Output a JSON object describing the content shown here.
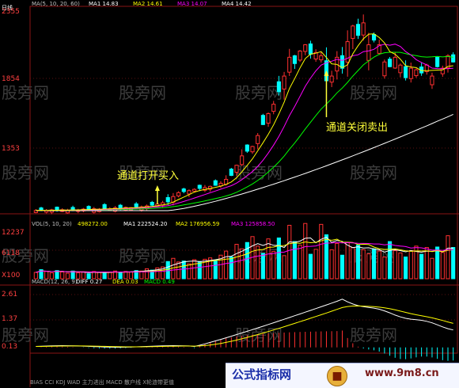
{
  "window": {
    "title": "日线"
  },
  "colors": {
    "up": "#ff3030",
    "down": "#00ffff",
    "ma5": "#ffffff",
    "ma10": "#ffff00",
    "ma20": "#ff00ff",
    "ma60": "#00ff00"
  },
  "watermarks": [
    "股旁网",
    "股旁网",
    "股旁网",
    "股旁网",
    "股旁网",
    "股旁网",
    "股旁网",
    "股旁网",
    "股旁网",
    "股旁网",
    "股旁网",
    "股旁网"
  ],
  "chart_data": [
    {
      "type": "candlestick",
      "title": "MA(5, 10, 20, 60)",
      "legend": [
        {
          "name": "MA1",
          "value": "14.83"
        },
        {
          "name": "MA2",
          "value": "14.61"
        },
        {
          "name": "MA3",
          "value": "14.07"
        },
        {
          "name": "MA4",
          "value": "14.42"
        }
      ],
      "yticks": [
        "2355",
        "1854",
        "1353"
      ],
      "annotations": [
        {
          "text": "通道打开买入",
          "at_index": 23
        },
        {
          "text": "通道关闭卖出",
          "at_index": 55
        }
      ],
      "close": [
        1101,
        1104,
        1100,
        1105,
        1103,
        1106,
        1102,
        1108,
        1105,
        1110,
        1107,
        1112,
        1109,
        1115,
        1112,
        1118,
        1116,
        1121,
        1119,
        1125,
        1124,
        1130,
        1135,
        1142,
        1150,
        1156,
        1190,
        1215,
        1222,
        1228,
        1236,
        1242,
        1248,
        1255,
        1262,
        1275,
        1300,
        1325,
        1390,
        1450,
        1480,
        1510,
        1580,
        1650,
        1720,
        1780,
        1860,
        1960,
        2080,
        2040,
        2120,
        2160,
        2100,
        2110,
        2090,
        1930,
        1960,
        2080,
        2010,
        2180,
        2280,
        2220,
        2300,
        2160,
        2190,
        2160,
        2050,
        2020,
        2080,
        2030,
        1950,
        2010,
        2000,
        1980,
        2030,
        1960,
        2020,
        2010,
        2090,
        2050
      ]
    },
    {
      "type": "bar",
      "title": "VOL(5, 10, 20)",
      "legend": [
        {
          "name": "VOL",
          "value": "498272.00"
        },
        {
          "name": "MA1",
          "value": "222524.20"
        },
        {
          "name": "MA2",
          "value": "176956.59"
        },
        {
          "name": "MA3",
          "value": "125858.50"
        }
      ],
      "yticks": [
        "12237",
        "6118",
        "X100"
      ],
      "values": [
        1400,
        2000,
        1600,
        1300,
        1800,
        1500,
        1200,
        1700,
        1300,
        1500,
        1100,
        1600,
        1400,
        1300,
        1500,
        1700,
        1400,
        1600,
        1500,
        1800,
        1700,
        2200,
        1900,
        2400,
        2600,
        3800,
        4500,
        3700,
        3900,
        3300,
        4200,
        3800,
        4300,
        4600,
        4100,
        5200,
        6100,
        4800,
        7600,
        6600,
        8000,
        9300,
        7200,
        5600,
        8800,
        6000,
        9000,
        5100,
        11800,
        8200,
        7400,
        12200,
        5400,
        6500,
        12000,
        9700,
        6400,
        7800,
        5200,
        8000,
        6900,
        7400,
        6400,
        5500,
        6600,
        6100,
        4800,
        8200,
        6200,
        5700,
        4800,
        6200,
        7200,
        5400,
        6900,
        4500,
        7000,
        5800,
        9500,
        6900
      ],
      "ylim": [
        0,
        12237
      ]
    },
    {
      "type": "line",
      "title": "MACD(12, 26, 9)",
      "legend": [
        {
          "name": "DIFF",
          "value": "0.27"
        },
        {
          "name": "DEA",
          "value": "0.03"
        },
        {
          "name": "MACD",
          "value": "0.49"
        }
      ],
      "yticks": [
        "2.61",
        "1.37",
        "0.13"
      ],
      "ylim": [
        -0.3,
        3.0
      ]
    }
  ],
  "bottom_tabs": "BIAS  CCI  KDJ  WAD  主力进出  MACD  散户线  X轮涟带更值"
}
